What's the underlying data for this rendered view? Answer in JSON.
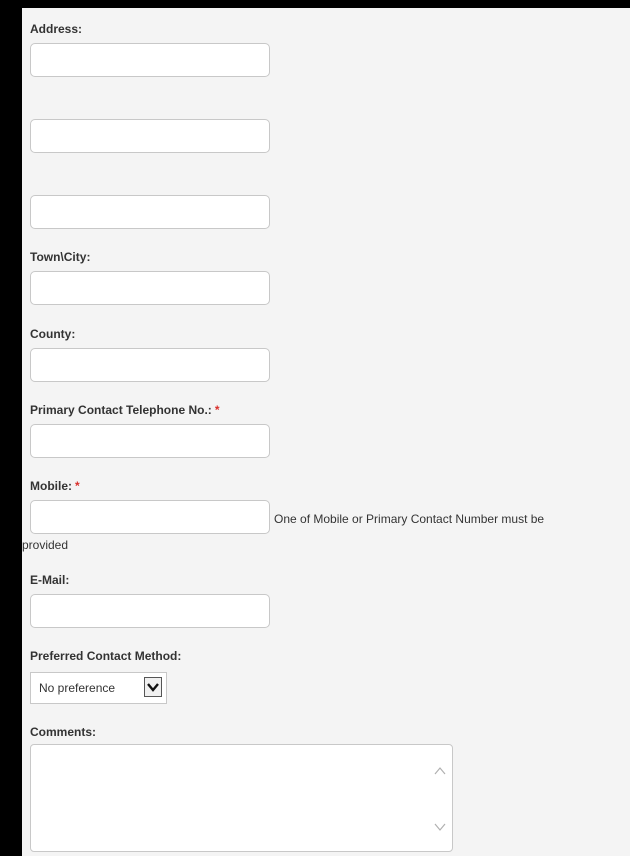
{
  "form": {
    "address_label": "Address:",
    "town_label": "Town\\City:",
    "county_label": "County:",
    "phone_label": "Primary Contact Telephone No.:",
    "phone_required_marker": "*",
    "mobile_label": "Mobile:",
    "mobile_required_marker": "*",
    "mobile_helper_line1": "One of Mobile or Primary Contact Number must be",
    "mobile_helper_line2": "provided",
    "email_label": "E-Mail:",
    "contact_method_label": "Preferred Contact Method:",
    "contact_method_selected": "No preference",
    "comments_label": "Comments:"
  },
  "values": {
    "address_line1": "",
    "address_line2": "",
    "address_line3": "",
    "town": "",
    "county": "",
    "phone": "",
    "mobile": "",
    "email": "",
    "comments": ""
  },
  "icons": {
    "select_arrow": "chevron-down-icon",
    "scroll_up": "chevron-up-icon",
    "scroll_down": "chevron-down-icon"
  },
  "colors": {
    "background": "#f4f4f4",
    "frame": "#000000",
    "required_marker": "#d9302c",
    "input_border": "#c8c8c8",
    "text": "#333333"
  }
}
